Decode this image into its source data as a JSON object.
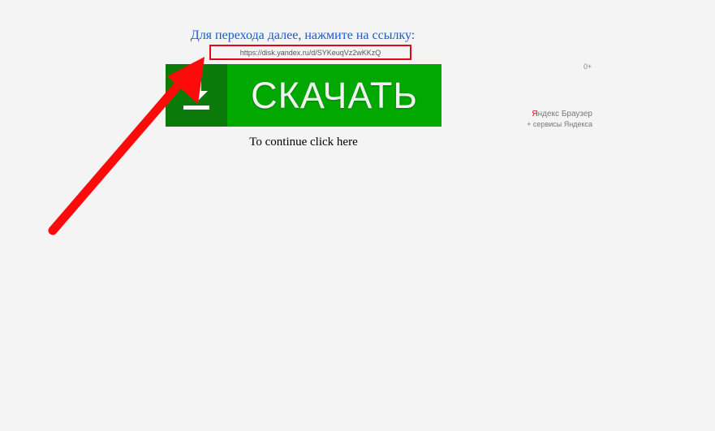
{
  "instruction": "Для перехода далее, нажмите на ссылку:",
  "link": {
    "url_text": "https://disk.yandex.ru/d/SYKeuqVz2wKKzQ"
  },
  "download_button": {
    "label": "СКАЧАТЬ",
    "icon": "download-icon"
  },
  "continue_text": "To continue click here",
  "age_rating": "0+",
  "ad": {
    "brand_prefix": "Я",
    "brand_rest": "ндекс Браузер",
    "subtitle": "+ сервисы Яндекса"
  },
  "annotation": {
    "arrow_color": "#ff0a0a",
    "box_color": "#e30613"
  },
  "colors": {
    "download_dark_green": "#0a7a0a",
    "download_green": "#00a800",
    "instruction_blue": "#1a5cc8"
  }
}
